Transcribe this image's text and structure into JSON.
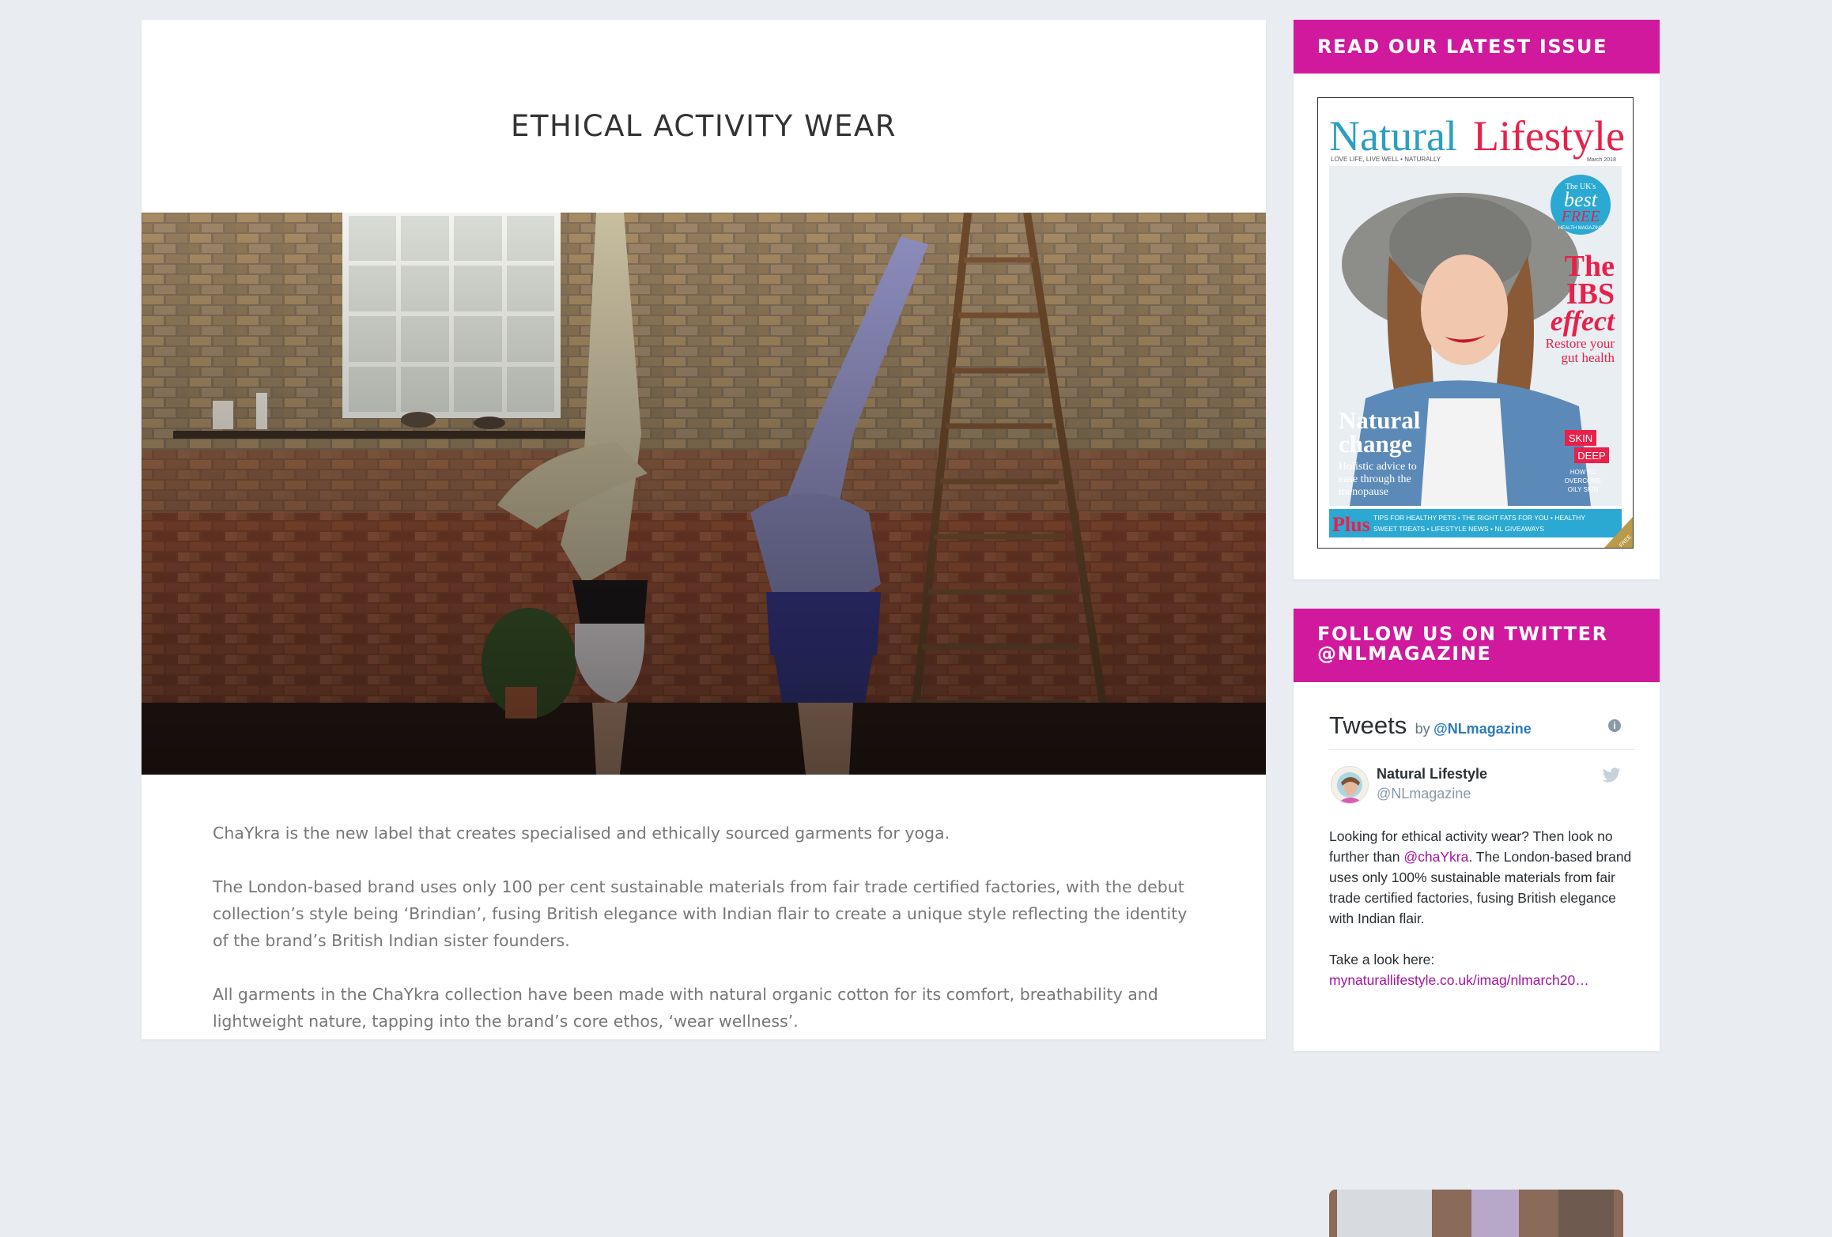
{
  "article": {
    "title": "ETHICAL ACTIVITY WEAR",
    "paragraphs": [
      "ChaYkra is the new label that creates specialised and ethically sourced garments for yoga.",
      "The London-based brand uses only 100 per cent sustainable materials from fair trade certified factories, with the debut collection’s style being ‘Brindian’, fusing British elegance with Indian flair to create a unique style reflecting the identity of the brand’s British Indian sister founders.",
      "All garments in the ChaYkra collection have been made with natural organic cotton for its comfort, breathability and lightweight nature, tapping into the brand’s core ethos, ‘wear wellness’."
    ]
  },
  "sidebar": {
    "latest_issue": {
      "heading": "READ OUR LATEST ISSUE",
      "cover": {
        "masthead_a": "Natural",
        "masthead_b": "Lifestyle",
        "tagline": "LOVE LIFE, LIVE WELL • NATURALLY",
        "issue": "March 2018",
        "badge_1": "The UK's",
        "badge_2": "best",
        "badge_3": "FREE",
        "badge_4": "HEALTH MAGAZINE",
        "headline_1": "The",
        "headline_2": "IBS",
        "headline_3": "effect",
        "headline_sub_1": "Restore your",
        "headline_sub_2": "gut health",
        "side_1": "Natural",
        "side_2": "change",
        "side_sub_1": "Holistic advice to",
        "side_sub_2": "ease through the",
        "side_sub_3": "menopause",
        "skin_1": "SKIN",
        "skin_2": "DEEP",
        "skin_sub_1": "HOW TO",
        "skin_sub_2": "OVERCOME",
        "skin_sub_3": "OILY SKIN",
        "plus": "Plus",
        "plus_line_1": "TIPS FOR HEALTHY PETS • THE RIGHT FATS FOR YOU • HEALTHY",
        "plus_line_2": "SWEET TREATS • LIFESTYLE NEWS • NL GIVEAWAYS",
        "corner": "FREE"
      }
    },
    "twitter": {
      "heading_line1": "FOLLOW US ON TWITTER",
      "heading_line2": "@NLMAGAZINE",
      "timeline_title": "Tweets",
      "by": "by",
      "handle_link": "@NLmagazine",
      "info": "i",
      "tweet": {
        "name": "Natural Lifestyle",
        "screen_name": "@NLmagazine",
        "text_before": "Looking for ethical activity wear? Then look no further than ",
        "mention": "@chaYkra",
        "text_after": ". The London-based brand uses only 100% sustainable materials from fair trade certified factories, fusing British elegance with Indian flair.",
        "cta": "Take a look here:",
        "link": "mynaturallifestyle.co.uk/imag/nlmarch20…"
      }
    }
  },
  "colors": {
    "page_bg": "#e9ecf1",
    "widget_header": "#d0199c",
    "link_purple": "#a1149e",
    "twitter_blue": "#2b7bb9"
  }
}
